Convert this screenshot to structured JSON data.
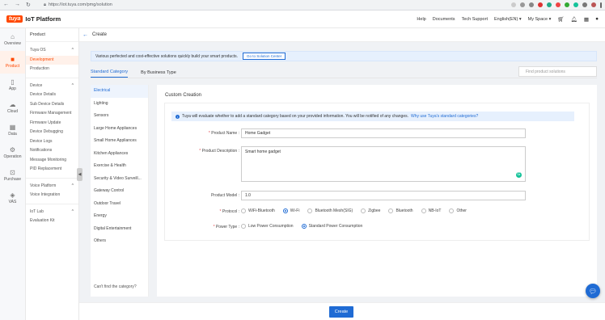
{
  "browser": {
    "url": "https://iot.tuya.com/pmg/solution"
  },
  "app": {
    "logo_brand": "tuya",
    "logo_title": "IoT Platform",
    "topmenu": {
      "help": "Help",
      "documents": "Documents",
      "tech_support": "Tech Support",
      "language": "English(EN) ▾",
      "myspace": "My Space ▾"
    }
  },
  "rail": [
    {
      "label": "Overview",
      "icon": "home-icon",
      "glyph": "⌂"
    },
    {
      "label": "Product",
      "icon": "product-icon",
      "glyph": "■"
    },
    {
      "label": "App",
      "icon": "phone-icon",
      "glyph": "▯"
    },
    {
      "label": "Cloud",
      "icon": "cloud-icon",
      "glyph": "☁"
    },
    {
      "label": "Data",
      "icon": "calendar-icon",
      "glyph": "▦"
    },
    {
      "label": "Operation",
      "icon": "gear-icon",
      "glyph": "⚙"
    },
    {
      "label": "Purchase",
      "icon": "cart-icon",
      "glyph": "⊡"
    },
    {
      "label": "VAS",
      "icon": "layers-icon",
      "glyph": "◈"
    }
  ],
  "sidebar": {
    "header": "Product",
    "group1": "Tuya OS",
    "group1_items": [
      "Development",
      "Production"
    ],
    "group2": "Device",
    "group2_items": [
      "Device Details",
      "Sub Device Details",
      "Firmware Management",
      "Firmware Update",
      "Device Debugging",
      "Device Logs",
      "Notifications",
      "Message Monitoring",
      "PID Replacement"
    ],
    "group3": "Voice Platform",
    "group3_items": [
      "Voice Integration"
    ],
    "group4": "IoT Lab",
    "group4_items": [
      "Evaluation Kit"
    ]
  },
  "page": {
    "title": "Create",
    "banner_text": "Various perfected and cost-effective solutions quickly build your smart products.",
    "banner_button": "Go to Solution Center",
    "tabs": [
      "Standard Category",
      "By Business Type"
    ],
    "search_placeholder": "Find product solutions",
    "categories": [
      "Electrical",
      "Lighting",
      "Sensors",
      "Large Home Appliances",
      "Small Home Appliances",
      "Kitchen Appliances",
      "Exercise & Health",
      "Security & Video Surveill...",
      "Gateway Control",
      "Outdoor Travel",
      "Energy",
      "Digital Entertainment",
      "Others"
    ],
    "cant_find": "Can't find the category?",
    "custom_title": "Custom Creation",
    "info_text": "Tuya will evaluate whether to add a standard category based on your provided information. You will be notified of any changes.",
    "info_link": "Why use Tuya's standard categories?",
    "form": {
      "name_label": "Product Name :",
      "name_value": "Home Gadget",
      "desc_label": "Product Description :",
      "desc_value": "Smart home gadget",
      "model_label": "Product Model :",
      "model_value": "1.0",
      "protocol_label": "Protocol :",
      "protocols": [
        "WiFi-Bluetooth",
        "Wi-Fi",
        "Bluetooth Mesh(SIG)",
        "Zigbee",
        "Bluetooth",
        "NB-IoT",
        "Other"
      ],
      "protocol_selected": "Wi-Fi",
      "power_label": "Power Type :",
      "power_types": [
        "Low Power Consumption",
        "Standard Power Consumption"
      ],
      "power_selected": "Standard Power Consumption"
    },
    "create_button": "Create"
  },
  "colors": {
    "accent": "#1f6bd4",
    "brand": "#ff4800"
  }
}
